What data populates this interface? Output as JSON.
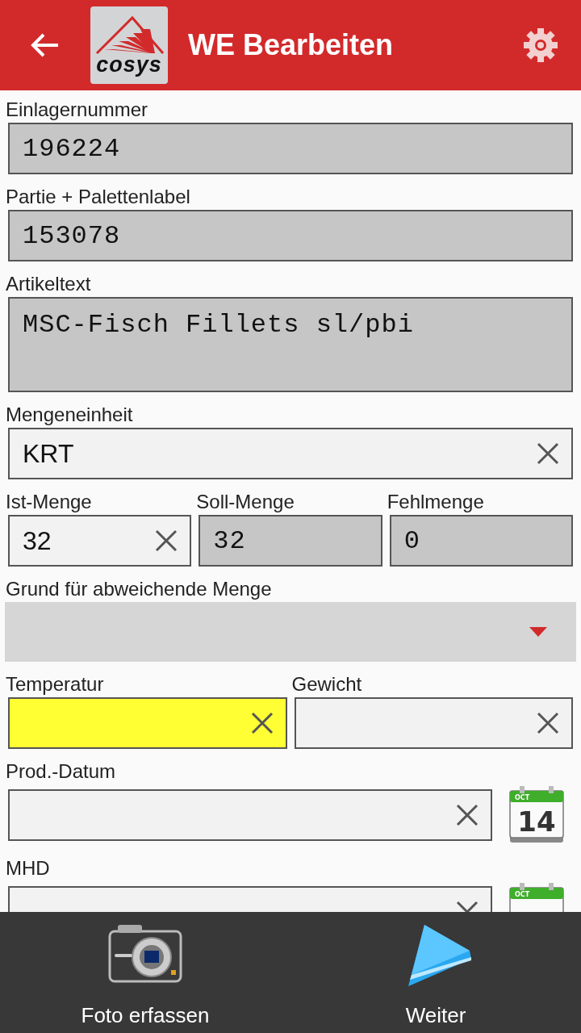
{
  "app_bar": {
    "title": "WE Bearbeiten",
    "logo_text": "cosys"
  },
  "rows": [
    {
      "fields": [
        {
          "label": "Einlagernummer",
          "kind": "readonly",
          "value": "196224"
        }
      ]
    },
    {
      "fields": [
        {
          "label": "Partie + Palettenlabel",
          "kind": "readonly",
          "value": "153078"
        }
      ]
    },
    {
      "fields": [
        {
          "label": "Artikeltext",
          "kind": "readonly",
          "value": "MSC-Fisch Fillets sl/pbi",
          "multiline": true
        }
      ]
    },
    {
      "fields": [
        {
          "label": "Mengeneinheit",
          "kind": "editable",
          "value": "KRT",
          "highlighted": false
        }
      ]
    },
    {
      "fields": [
        {
          "label": "Ist-Menge",
          "kind": "editable",
          "value": "32",
          "highlighted": false
        },
        {
          "label": "Soll-Menge",
          "kind": "readonly",
          "value": "32"
        },
        {
          "label": "Fehlmenge",
          "kind": "readonly",
          "value": "0"
        }
      ]
    },
    {
      "fields": [
        {
          "label": "Grund für abweichende Menge",
          "kind": "dropdown"
        }
      ]
    },
    {
      "fields": [
        {
          "label": "Temperatur",
          "kind": "editable",
          "highlighted": true
        },
        {
          "label": "Gewicht",
          "kind": "editable",
          "highlighted": false
        }
      ]
    },
    {
      "fields": [
        {
          "label": "Prod.-Datum",
          "kind": "editable",
          "highlighted": false,
          "calendar": {
            "month": "OCT",
            "day": "14"
          }
        }
      ]
    },
    {
      "fields": [
        {
          "label": "MHD",
          "kind": "editable",
          "highlighted": false,
          "calendar": {
            "month": "OCT"
          }
        }
      ]
    }
  ],
  "bottom_actions": [
    {
      "label": "Foto erfassen",
      "kind": "camera"
    },
    {
      "label": "Weiter",
      "kind": "next"
    }
  ]
}
